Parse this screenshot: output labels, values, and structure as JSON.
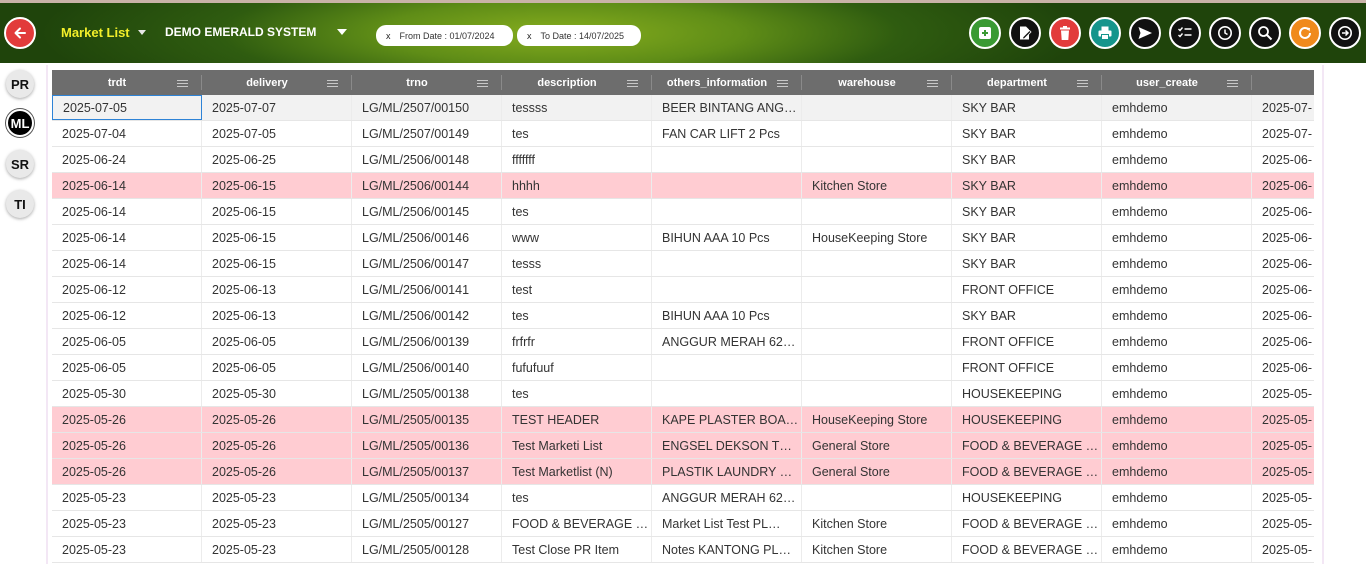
{
  "header": {
    "title": "Market List",
    "system_name": "DEMO EMERALD SYSTEM",
    "filters": [
      {
        "label": "From Date : 01/07/2024",
        "close": "x"
      },
      {
        "label": "To Date : 14/07/2025",
        "close": "x"
      }
    ],
    "toolbar": [
      {
        "name": "add-button",
        "icon": "plus-square-icon",
        "color": "#3a9a33"
      },
      {
        "name": "edit-button",
        "icon": "edit-doc-icon",
        "color": "#111111"
      },
      {
        "name": "delete-button",
        "icon": "trash-icon",
        "color": "#e23b3b"
      },
      {
        "name": "print-button",
        "icon": "printer-icon",
        "color": "#15958c"
      },
      {
        "name": "send-button",
        "icon": "send-icon",
        "color": "#111111"
      },
      {
        "name": "checklist-button",
        "icon": "checklist-icon",
        "color": "#111111"
      },
      {
        "name": "history-button",
        "icon": "clock-icon",
        "color": "#111111"
      },
      {
        "name": "search-button",
        "icon": "search-icon",
        "color": "#111111"
      },
      {
        "name": "refresh-button",
        "icon": "refresh-icon",
        "color": "#f08a1c"
      },
      {
        "name": "exit-button",
        "icon": "exit-icon",
        "color": "#111111"
      }
    ]
  },
  "left_nav": [
    {
      "label": "PR",
      "active": false
    },
    {
      "label": "ML",
      "active": true
    },
    {
      "label": "SR",
      "active": false
    },
    {
      "label": "TI",
      "active": false
    }
  ],
  "table": {
    "columns": [
      "trdt",
      "delivery",
      "trno",
      "description",
      "others_information",
      "warehouse",
      "department",
      "user_create",
      ""
    ],
    "rows": [
      {
        "cells": [
          "2025-07-05",
          "2025-07-07",
          "LG/ML/2507/00150",
          "tessss",
          "BEER BINTANG ANG…",
          "",
          "SKY BAR",
          "emhdemo",
          "2025-07-"
        ],
        "pink": false
      },
      {
        "cells": [
          "2025-07-04",
          "2025-07-05",
          "LG/ML/2507/00149",
          "tes",
          "FAN CAR LIFT 2 Pcs",
          "",
          "SKY BAR",
          "emhdemo",
          "2025-07-"
        ],
        "pink": false
      },
      {
        "cells": [
          "2025-06-24",
          "2025-06-25",
          "LG/ML/2506/00148",
          "fffffff",
          "",
          "",
          "SKY BAR",
          "emhdemo",
          "2025-06-"
        ],
        "pink": false
      },
      {
        "cells": [
          "2025-06-14",
          "2025-06-15",
          "LG/ML/2506/00144",
          "hhhh",
          "",
          "Kitchen Store",
          "SKY BAR",
          "emhdemo",
          "2025-06-"
        ],
        "pink": true
      },
      {
        "cells": [
          "2025-06-14",
          "2025-06-15",
          "LG/ML/2506/00145",
          "tes",
          "",
          "",
          "SKY BAR",
          "emhdemo",
          "2025-06-"
        ],
        "pink": false
      },
      {
        "cells": [
          "2025-06-14",
          "2025-06-15",
          "LG/ML/2506/00146",
          "www",
          "BIHUN AAA 10 Pcs",
          "HouseKeeping Store",
          "SKY BAR",
          "emhdemo",
          "2025-06-"
        ],
        "pink": false
      },
      {
        "cells": [
          "2025-06-14",
          "2025-06-15",
          "LG/ML/2506/00147",
          "tesss",
          "",
          "",
          "SKY BAR",
          "emhdemo",
          "2025-06-"
        ],
        "pink": false
      },
      {
        "cells": [
          "2025-06-12",
          "2025-06-13",
          "LG/ML/2506/00141",
          "test",
          "",
          "",
          "FRONT OFFICE",
          "emhdemo",
          "2025-06-"
        ],
        "pink": false
      },
      {
        "cells": [
          "2025-06-12",
          "2025-06-13",
          "LG/ML/2506/00142",
          "tes",
          "BIHUN AAA 10 Pcs",
          "",
          "SKY BAR",
          "emhdemo",
          "2025-06-"
        ],
        "pink": false
      },
      {
        "cells": [
          "2025-06-05",
          "2025-06-05",
          "LG/ML/2506/00139",
          "frfrfr",
          "ANGGUR MERAH 62…",
          "",
          "FRONT OFFICE",
          "emhdemo",
          "2025-06-"
        ],
        "pink": false
      },
      {
        "cells": [
          "2025-06-05",
          "2025-06-05",
          "LG/ML/2506/00140",
          "fufufuuf",
          "",
          "",
          "FRONT OFFICE",
          "emhdemo",
          "2025-06-"
        ],
        "pink": false
      },
      {
        "cells": [
          "2025-05-30",
          "2025-05-30",
          "LG/ML/2505/00138",
          "tes",
          "",
          "",
          "HOUSEKEEPING",
          "emhdemo",
          "2025-05-"
        ],
        "pink": false
      },
      {
        "cells": [
          "2025-05-26",
          "2025-05-26",
          "LG/ML/2505/00135",
          "TEST HEADER",
          "KAPE PLASTER BOA…",
          "HouseKeeping Store",
          "HOUSEKEEPING",
          "emhdemo",
          "2025-05-"
        ],
        "pink": true
      },
      {
        "cells": [
          "2025-05-26",
          "2025-05-26",
          "LG/ML/2505/00136",
          "Test Marketi List",
          "ENGSEL DEKSON T…",
          "General Store",
          "FOOD & BEVERAGE …",
          "emhdemo",
          "2025-05-"
        ],
        "pink": true
      },
      {
        "cells": [
          "2025-05-26",
          "2025-05-26",
          "LG/ML/2505/00137",
          "Test Marketlist (N)",
          "PLASTIK  LAUNDRY …",
          "General Store",
          "FOOD & BEVERAGE …",
          "emhdemo",
          "2025-05-"
        ],
        "pink": true
      },
      {
        "cells": [
          "2025-05-23",
          "2025-05-23",
          "LG/ML/2505/00134",
          "tes",
          "ANGGUR MERAH 62…",
          "",
          "HOUSEKEEPING",
          "emhdemo",
          "2025-05-"
        ],
        "pink": false
      },
      {
        "cells": [
          "2025-05-23",
          "2025-05-23",
          "LG/ML/2505/00127",
          "FOOD & BEVERAGE …",
          "Market List Test PL…",
          "Kitchen Store",
          "FOOD & BEVERAGE …",
          "emhdemo",
          "2025-05-"
        ],
        "pink": false
      },
      {
        "cells": [
          "2025-05-23",
          "2025-05-23",
          "LG/ML/2505/00128",
          "Test Close PR Item",
          "Notes KANTONG PL…",
          "Kitchen Store",
          "FOOD & BEVERAGE …",
          "emhdemo",
          "2025-05-"
        ],
        "pink": false
      }
    ]
  },
  "colors": {
    "header_green": "#5f8d17",
    "title_yellow": "#f2ee2a",
    "row_pink": "#ffccd2",
    "header_gray": "#6d6d6d",
    "selection_blue": "#2e83d6"
  }
}
